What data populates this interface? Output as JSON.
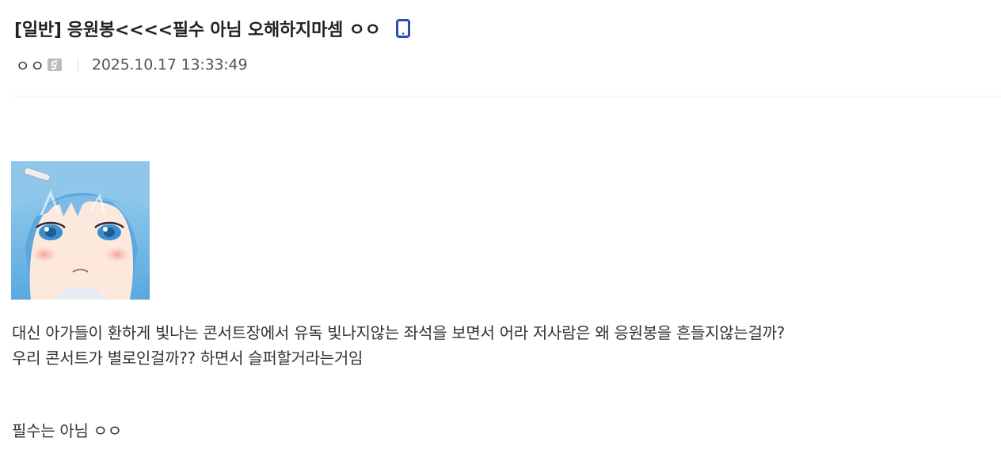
{
  "post": {
    "head": "[일반]",
    "title": "응원봉<<<<필수 아님 오해하지마셈 ㅇㅇ",
    "device_icon": "mobile-phone-icon",
    "author": "ㅇㅇ",
    "author_badge_icon": "fixed-nick-icon",
    "date": "2025.10.17 13:33:49",
    "image_subject": "anime girl with blue hair",
    "body_lines": [
      "대신 아가들이 환하게 빛나는 콘서트장에서 유독 빛나지않는 좌석을 보면서 어라 저사람은 왜 응원봉을 흔들지않는걸까?",
      "우리 콘서트가 별로인걸까?? 하면서 슬퍼할거라는거임"
    ],
    "footer_line": "필수는 아님 ㅇㅇ"
  },
  "colors": {
    "title": "#222222",
    "text": "#333333",
    "date": "#555555",
    "divider": "#eeeeee",
    "mobile_icon": "#2c4db0",
    "badge_icon": "#bbbbbb"
  }
}
